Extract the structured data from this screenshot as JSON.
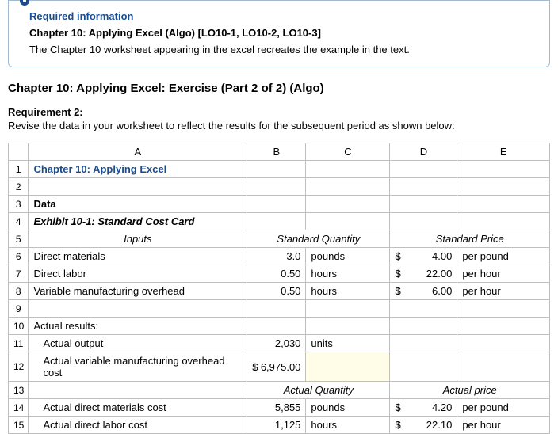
{
  "info": {
    "required": "Required information",
    "chapter": "Chapter 10: Applying Excel (Algo) [LO10-1, LO10-2, LO10-3]",
    "desc": "The Chapter 10 worksheet appearing in the excel recreates the example in the text."
  },
  "section_title": "Chapter 10: Applying Excel: Exercise (Part 2 of 2) (Algo)",
  "requirement": {
    "label": "Requirement 2:",
    "text": "Revise the data in your worksheet to reflect the results for the subsequent period as shown below:"
  },
  "headers": {
    "A": "A",
    "B": "B",
    "C": "C",
    "D": "D",
    "E": "E"
  },
  "rows": {
    "r1": {
      "n": "1",
      "A": "Chapter 10: Applying Excel"
    },
    "r2": {
      "n": "2"
    },
    "r3": {
      "n": "3",
      "A": "Data"
    },
    "r4": {
      "n": "4",
      "A": "Exhibit 10-1: Standard Cost Card"
    },
    "r5": {
      "n": "5",
      "A": "Inputs",
      "BC": "Standard Quantity",
      "DE": "Standard Price"
    },
    "r6": {
      "n": "6",
      "A": "Direct materials",
      "B": "3.0",
      "C": "pounds",
      "Dp": "$",
      "D": "4.00",
      "E": "per pound"
    },
    "r7": {
      "n": "7",
      "A": "Direct labor",
      "B": "0.50",
      "C": "hours",
      "Dp": "$",
      "D": "22.00",
      "E": "per hour"
    },
    "r8": {
      "n": "8",
      "A": "Variable manufacturing overhead",
      "B": "0.50",
      "C": "hours",
      "Dp": "$",
      "D": "6.00",
      "E": "per hour"
    },
    "r9": {
      "n": "9"
    },
    "r10": {
      "n": "10",
      "A": "Actual results:"
    },
    "r11": {
      "n": "11",
      "A": "Actual output",
      "B": "2,030",
      "C": "units"
    },
    "r12": {
      "n": "12",
      "A": "Actual variable manufacturing overhead cost",
      "Bp": "$",
      "B": "6,975.00"
    },
    "r13": {
      "n": "13",
      "BC": "Actual Quantity",
      "DE": "Actual price"
    },
    "r14": {
      "n": "14",
      "A": "Actual direct materials cost",
      "B": "5,855",
      "C": "pounds",
      "Dp": "$",
      "D": "4.20",
      "E": "per pound"
    },
    "r15": {
      "n": "15",
      "A": "Actual direct labor cost",
      "B": "1,125",
      "C": "hours",
      "Dp": "$",
      "D": "22.10",
      "E": "per hour"
    }
  },
  "chart_data": {
    "type": "table",
    "title": "Standard Cost Card and Actual Results",
    "standard": [
      {
        "input": "Direct materials",
        "qty": 3.0,
        "qty_unit": "pounds",
        "price": 4.0,
        "price_unit": "per pound"
      },
      {
        "input": "Direct labor",
        "qty": 0.5,
        "qty_unit": "hours",
        "price": 22.0,
        "price_unit": "per hour"
      },
      {
        "input": "Variable manufacturing overhead",
        "qty": 0.5,
        "qty_unit": "hours",
        "price": 6.0,
        "price_unit": "per hour"
      }
    ],
    "actual": {
      "output": {
        "value": 2030,
        "unit": "units"
      },
      "variable_moh_cost": 6975.0,
      "direct_materials": {
        "qty": 5855,
        "qty_unit": "pounds",
        "price": 4.2,
        "price_unit": "per pound"
      },
      "direct_labor": {
        "qty": 1125,
        "qty_unit": "hours",
        "price": 22.1,
        "price_unit": "per hour"
      }
    }
  }
}
